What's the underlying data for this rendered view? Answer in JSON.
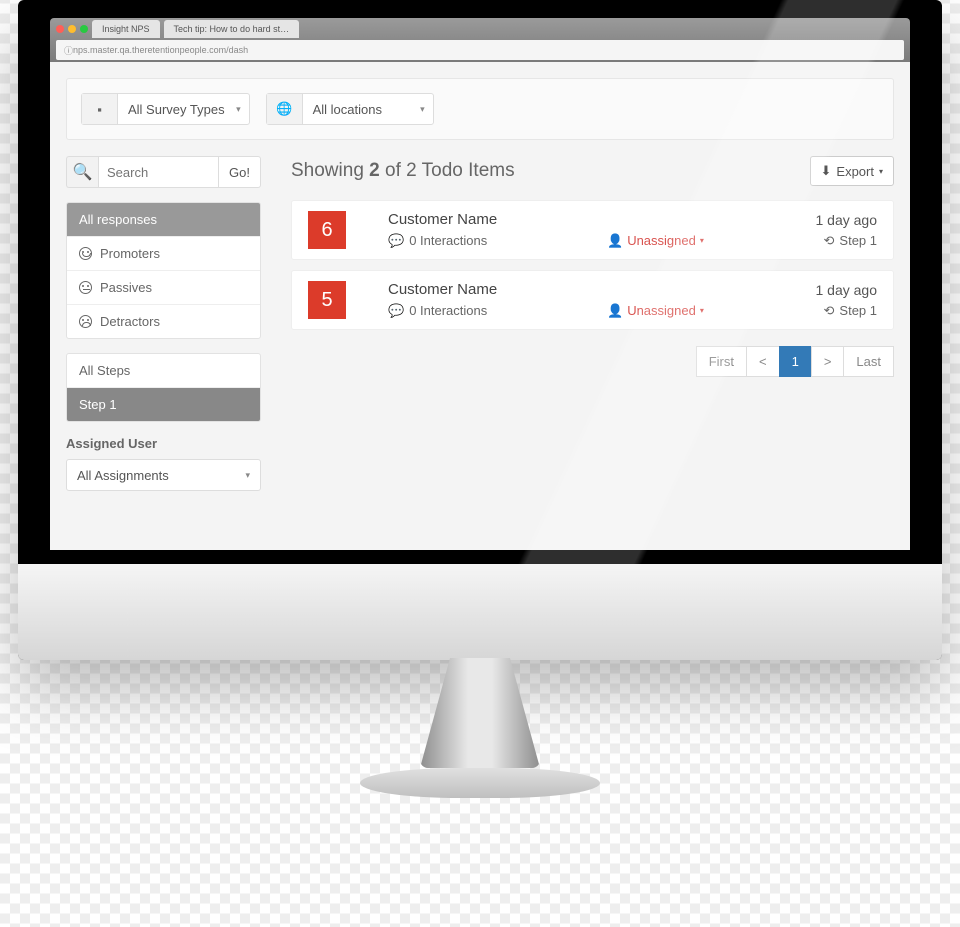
{
  "browser": {
    "tab1": "Insight NPS",
    "tab2": "Tech tip: How to do hard st…",
    "url": "nps.master.qa.theretentionpeople.com/dash"
  },
  "filters": {
    "survey": "All Survey Types",
    "location": "All locations"
  },
  "search": {
    "placeholder": "Search",
    "go": "Go!"
  },
  "responses": {
    "all": "All responses",
    "prom": "Promoters",
    "pass": "Passives",
    "det": "Detractors"
  },
  "steps": {
    "all": "All Steps",
    "s1": "Step 1"
  },
  "assign": {
    "label": "Assigned User",
    "value": "All Assignments"
  },
  "header": {
    "p1": "Showing ",
    "n": "2",
    "p2": " of 2 Todo Items",
    "export": "Export"
  },
  "items": [
    {
      "score": "6",
      "name": "Customer Name",
      "inter": "0 Interactions",
      "assn": "Unassigned",
      "time": "1 day ago",
      "step": "Step 1"
    },
    {
      "score": "5",
      "name": "Customer Name",
      "inter": "0 Interactions",
      "assn": "Unassigned",
      "time": "1 day ago",
      "step": "Step 1"
    }
  ],
  "pager": {
    "first": "First",
    "prev": "<",
    "p1": "1",
    "next": ">",
    "last": "Last"
  }
}
